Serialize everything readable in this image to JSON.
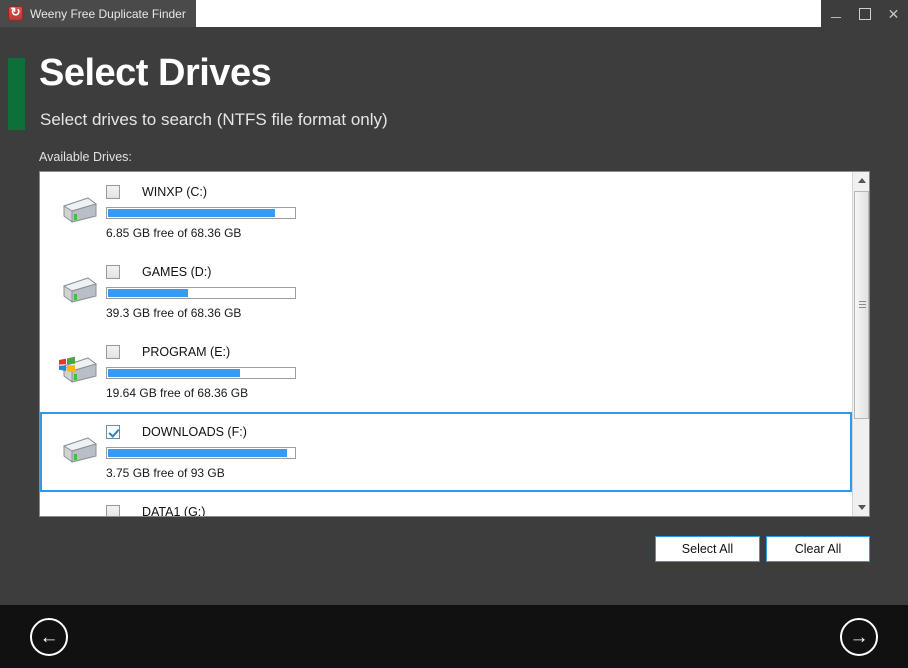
{
  "window": {
    "title": "Weeny Free Duplicate Finder",
    "app_icon": "duplicate-finder-icon",
    "controls": {
      "minimize": "–",
      "maximize": "□",
      "close": "✕"
    }
  },
  "header": {
    "title": "Select Drives",
    "subtitle": "Select drives to search (NTFS file format only)",
    "accent_color": "#0d7038"
  },
  "main": {
    "list_label": "Available Drives:",
    "drives": [
      {
        "name": "WINXP (C:)",
        "icon": "hard-drive-icon",
        "checked": false,
        "selected": false,
        "usage_percent": 90,
        "free_text": "6.85 GB free of 68.36 GB"
      },
      {
        "name": "GAMES (D:)",
        "icon": "hard-drive-icon",
        "checked": false,
        "selected": false,
        "usage_percent": 43,
        "free_text": "39.3 GB free of 68.36 GB"
      },
      {
        "name": "PROGRAM (E:)",
        "icon": "system-drive-icon",
        "checked": false,
        "selected": false,
        "usage_percent": 71,
        "free_text": "19.64 GB free of 68.36 GB"
      },
      {
        "name": "DOWNLOADS (F:)",
        "icon": "hard-drive-icon",
        "checked": true,
        "selected": true,
        "usage_percent": 96,
        "free_text": "3.75 GB free of 93 GB"
      },
      {
        "name": "DATA1 (G:)",
        "icon": "hard-drive-icon",
        "checked": false,
        "selected": false,
        "usage_percent": 0,
        "free_text": ""
      }
    ],
    "select_all_label": "Select All",
    "clear_all_label": "Clear All",
    "accent_color": "#2f9ae8"
  },
  "footer": {
    "back_label": "←",
    "next_label": "→"
  }
}
